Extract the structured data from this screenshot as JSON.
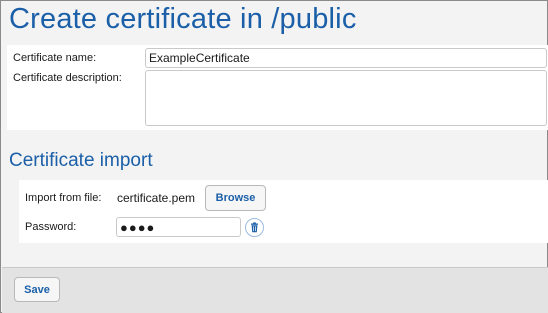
{
  "page": {
    "title": "Create certificate in /public"
  },
  "form": {
    "name_label": "Certificate name:",
    "name_value": "ExampleCertificate",
    "description_label": "Certificate description:",
    "description_value": ""
  },
  "import": {
    "section_title": "Certificate import",
    "file_label": "Import from file:",
    "file_name": "certificate.pem",
    "browse_label": "Browse",
    "password_label": "Password:",
    "password_value": "●●●●",
    "delete_icon": "trash-icon"
  },
  "footer": {
    "save_label": "Save"
  },
  "colors": {
    "accent": "#1b5fa8",
    "panel": "#ffffff",
    "background": "#f3f3f3",
    "footer": "#e3e3e3"
  }
}
